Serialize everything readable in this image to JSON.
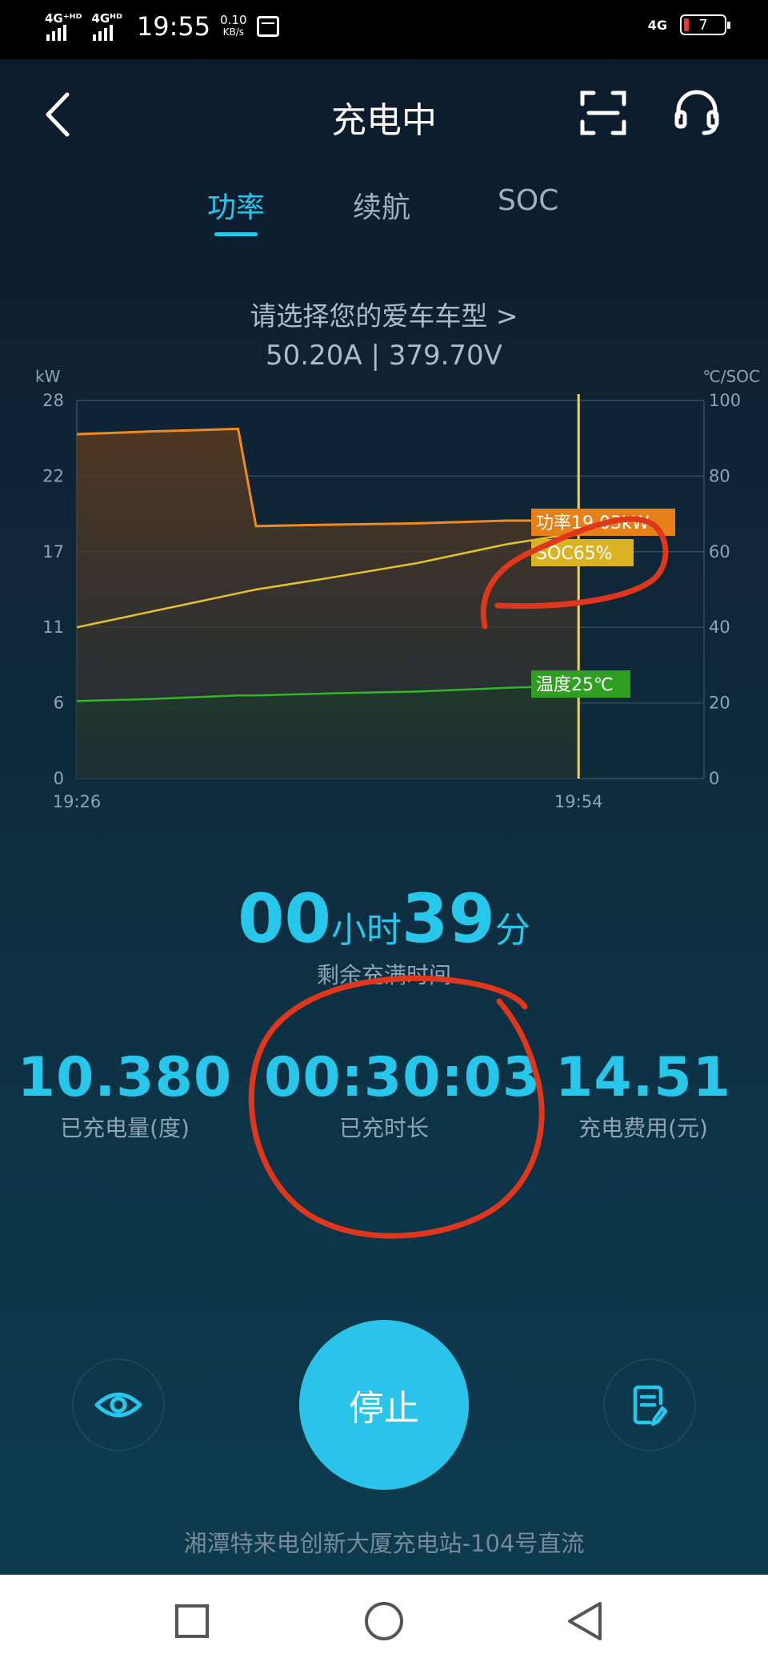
{
  "status_bar": {
    "net1": "4G⁺ᴴᴰ",
    "net2": "4Gᴴᴰ",
    "time": "19:55",
    "speed_value": "0.10",
    "speed_unit": "KB/s",
    "net_right": "4G",
    "battery": "7"
  },
  "header": {
    "title": "充电中"
  },
  "tabs": [
    {
      "label": "功率",
      "active": true
    },
    {
      "label": "续航",
      "active": false
    },
    {
      "label": "SOC",
      "active": false
    }
  ],
  "car_select": "请选择您的爱车车型 >",
  "readings": "50.20A | 379.70V",
  "chart_data": {
    "type": "line",
    "left_axis_unit": "kW",
    "right_axis_unit": "℃/SOC",
    "left_ticks": [
      "28",
      "22",
      "17",
      "11",
      "6",
      "0"
    ],
    "right_ticks": [
      "100",
      "80",
      "60",
      "40",
      "20",
      "0"
    ],
    "x_ticks": [
      "19:26",
      "19:54"
    ],
    "x": [
      "19:26",
      "19:30",
      "19:35",
      "19:36",
      "19:40",
      "19:45",
      "19:50",
      "19:54"
    ],
    "series": [
      {
        "axis": "left",
        "color": "#f08a1e",
        "values": [
          25.5,
          25.7,
          25.9,
          18.7,
          18.8,
          18.9,
          19.1,
          19.1
        ]
      },
      {
        "axis": "right",
        "color": "#e6c229",
        "values": [
          40,
          44,
          49,
          50,
          53,
          57,
          62,
          65
        ]
      },
      {
        "axis": "right",
        "color": "#36b427",
        "values": [
          20.5,
          21,
          22,
          22,
          22.5,
          23,
          24,
          24.5
        ]
      }
    ],
    "cursor_x": "19:54",
    "labels": {
      "power": "功率19.03kW",
      "soc": "SOC65%",
      "temp": "温度25℃"
    },
    "left_ylim": [
      0,
      28
    ],
    "right_ylim": [
      0,
      100
    ]
  },
  "remaining": {
    "hours": "00",
    "hours_unit": "小时",
    "minutes": "39",
    "minutes_unit": "分",
    "label": "剩余充满时间"
  },
  "stats": {
    "energy": {
      "value": "10.380",
      "label": "已充电量(度)"
    },
    "duration": {
      "value": "00:30:03",
      "label": "已充时长"
    },
    "cost": {
      "value": "14.51",
      "label": "充电费用(元)"
    }
  },
  "controls": {
    "stop_label": "停止"
  },
  "station": "湘潭特来电创新大厦充电站-104号直流",
  "colors": {
    "accent": "#27c7ec",
    "power": "#f08a1e",
    "soc": "#e6c229",
    "temperature": "#36b427",
    "annotation": "#e0361c"
  }
}
